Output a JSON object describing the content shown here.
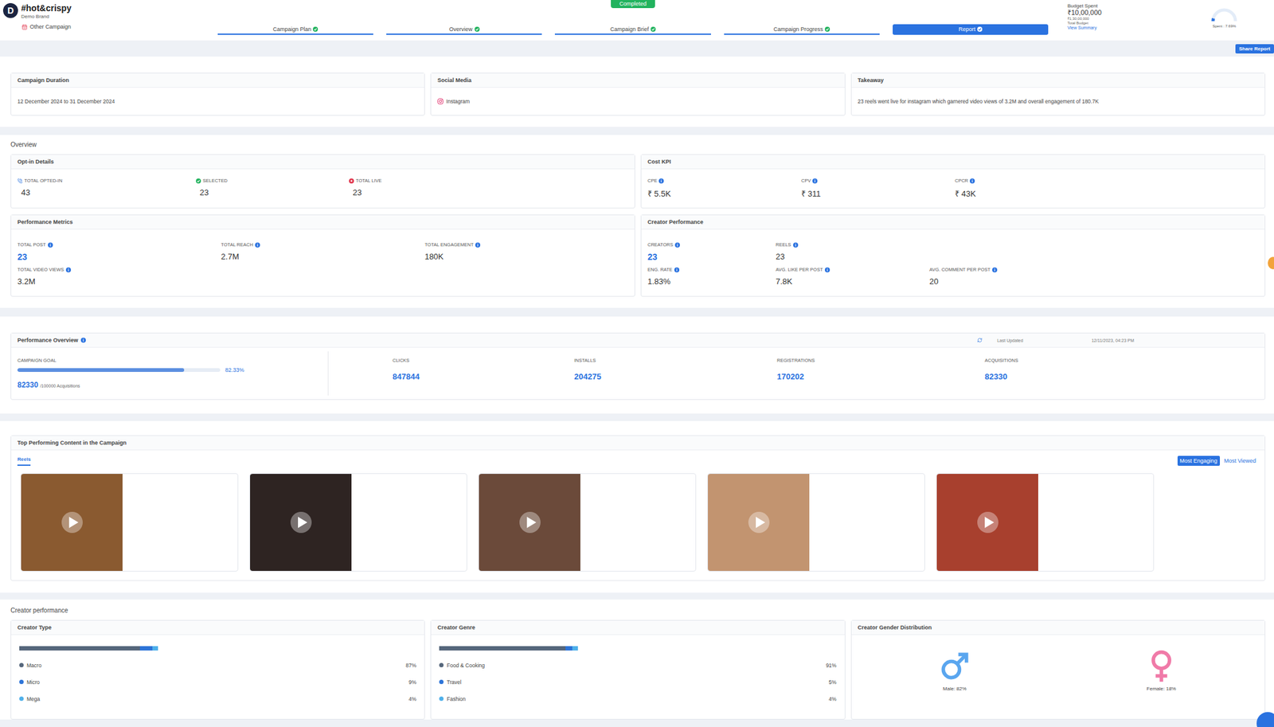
{
  "header": {
    "logo": "D",
    "title": "#hot&crispy",
    "brand": "Demo Brand",
    "other_campaign": "Other Campaign",
    "status": "Completed",
    "tabs": [
      {
        "label": "Campaign Plan",
        "done": true,
        "selected": false
      },
      {
        "label": "Overview",
        "done": true,
        "selected": false
      },
      {
        "label": "Campaign Brief",
        "done": true,
        "selected": false
      },
      {
        "label": "Campaign Progress",
        "done": true,
        "selected": false
      },
      {
        "label": "Report",
        "done": true,
        "selected": true
      }
    ],
    "budget": {
      "label": "Budget Spent",
      "spent": "₹10,00,000",
      "total": "₹1,30,00,000",
      "total_label": "Total Budget",
      "link": "View Summary",
      "level": 0.0769,
      "reading": "Spent : 7.69%"
    }
  },
  "share_button": "Share Report",
  "summary": [
    {
      "title": "Campaign Duration",
      "value": "12 December 2024 to 31 December 2024",
      "kind": "text"
    },
    {
      "title": "Social Media",
      "value": "Instagram",
      "kind": "instagram"
    },
    {
      "title": "Takeaway",
      "value": "23 reels went live for instagram which garnered video views of 3.2M and overall engagement of 180.7K",
      "kind": "text"
    }
  ],
  "overview": {
    "title": "Overview",
    "panels": [
      {
        "title": "Opt-in Details",
        "kind": "opt-in",
        "rows": [
          [
            {
              "label": "TOTAL OPTED-IN",
              "value": "43",
              "kind": "contact",
              "highlight": false
            },
            {
              "label": "SELECTED",
              "value": "23",
              "kind": "selected",
              "highlight": false
            },
            {
              "label": "TOTAL LIVE",
              "value": "23",
              "kind": "live",
              "highlight": false
            }
          ]
        ]
      },
      {
        "title": "Cost KPI",
        "kind": "cost",
        "rows": [
          [
            {
              "label": "CPE",
              "value": "₹ 5.5K",
              "kind": "info",
              "highlight": false
            },
            {
              "label": "CPV",
              "value": "₹ 311",
              "kind": "info",
              "highlight": false
            },
            {
              "label": "CPCR",
              "value": "₹ 43K",
              "kind": "info",
              "highlight": false
            }
          ]
        ]
      },
      {
        "title": "Performance Metrics",
        "kind": "metrics",
        "rows": [
          [
            {
              "label": "TOTAL POST",
              "value": "23",
              "kind": "info",
              "highlight": true
            },
            {
              "label": "TOTAL REACH",
              "value": "2.7M",
              "kind": "info",
              "highlight": false
            },
            {
              "label": "TOTAL ENGAGEMENT",
              "value": "180K",
              "kind": "info",
              "highlight": false
            }
          ],
          [
            {
              "label": "TOTAL VIDEO VIEWS",
              "value": "3.2M",
              "kind": "info",
              "highlight": false
            }
          ]
        ]
      },
      {
        "title": "Creator Performance",
        "kind": "creators",
        "rows": [
          [
            {
              "label": "CREATORS",
              "value": "23",
              "kind": "info",
              "highlight": true
            },
            {
              "label": "REELS",
              "value": "23",
              "kind": "info",
              "highlight": false
            }
          ],
          [
            {
              "label": "ENG. RATE",
              "value": "1.83%",
              "kind": "info",
              "highlight": false
            },
            {
              "label": "AVG. LIKE PER POST",
              "value": "7.8K",
              "kind": "info",
              "highlight": false
            },
            {
              "label": "AVG. COMMENT PER POST",
              "value": "20",
              "kind": "info",
              "highlight": false
            }
          ]
        ]
      }
    ]
  },
  "performance": {
    "title": "Performance Overview",
    "last_updated_label": "Last Updated",
    "last_updated": "12/11/2023, 04:23 PM",
    "goal": {
      "label": "CAMPAIGN GOAL",
      "level": 0.8233,
      "percent": "82.33%",
      "value": "82330",
      "target": "/100000 Acquisitions"
    },
    "metrics": [
      {
        "label": "CLICKS",
        "value": "847844"
      },
      {
        "label": "INSTALLS",
        "value": "204275"
      },
      {
        "label": "REGISTRATIONS",
        "value": "170202"
      },
      {
        "label": "ACQUISITIONS",
        "value": "82330"
      }
    ]
  },
  "top_content": {
    "title": "Top Performing Content in the Campaign",
    "tabs": [
      {
        "label": "Reels",
        "selected": true
      }
    ],
    "sort": [
      {
        "label": "Most Engaging",
        "selected": true
      },
      {
        "label": "Most Viewed",
        "selected": false
      }
    ],
    "reels": [
      {
        "color": "#8a5a30"
      },
      {
        "color": "#2e2422"
      },
      {
        "color": "#6b4a3a"
      },
      {
        "color": "#c29470"
      },
      {
        "color": "#a8402e"
      }
    ]
  },
  "creator_performance": {
    "title": "Creator performance",
    "type": {
      "title": "Creator Type",
      "items": [
        {
          "label": "Macro",
          "percent": "87%",
          "level": 0.87,
          "color": "#56677c"
        },
        {
          "label": "Micro",
          "percent": "9%",
          "level": 0.09,
          "color": "#2d74d8"
        },
        {
          "label": "Mega",
          "percent": "4%",
          "level": 0.04,
          "color": "#4fb0ea"
        }
      ]
    },
    "genre": {
      "title": "Creator Genre",
      "items": [
        {
          "label": "Food & Cooking",
          "percent": "91%",
          "level": 0.91,
          "color": "#56677c"
        },
        {
          "label": "Travel",
          "percent": "5%",
          "level": 0.05,
          "color": "#2d74d8"
        },
        {
          "label": "Fashion",
          "percent": "4%",
          "level": 0.04,
          "color": "#4fb0ea"
        }
      ]
    },
    "gender": {
      "title": "Creator Gender Distribution",
      "items": [
        {
          "label": "Male: 82%",
          "kind": "male",
          "color": "#5aa6ef"
        },
        {
          "label": "Female: 18%",
          "kind": "female",
          "color": "#f07aa8"
        }
      ]
    }
  }
}
